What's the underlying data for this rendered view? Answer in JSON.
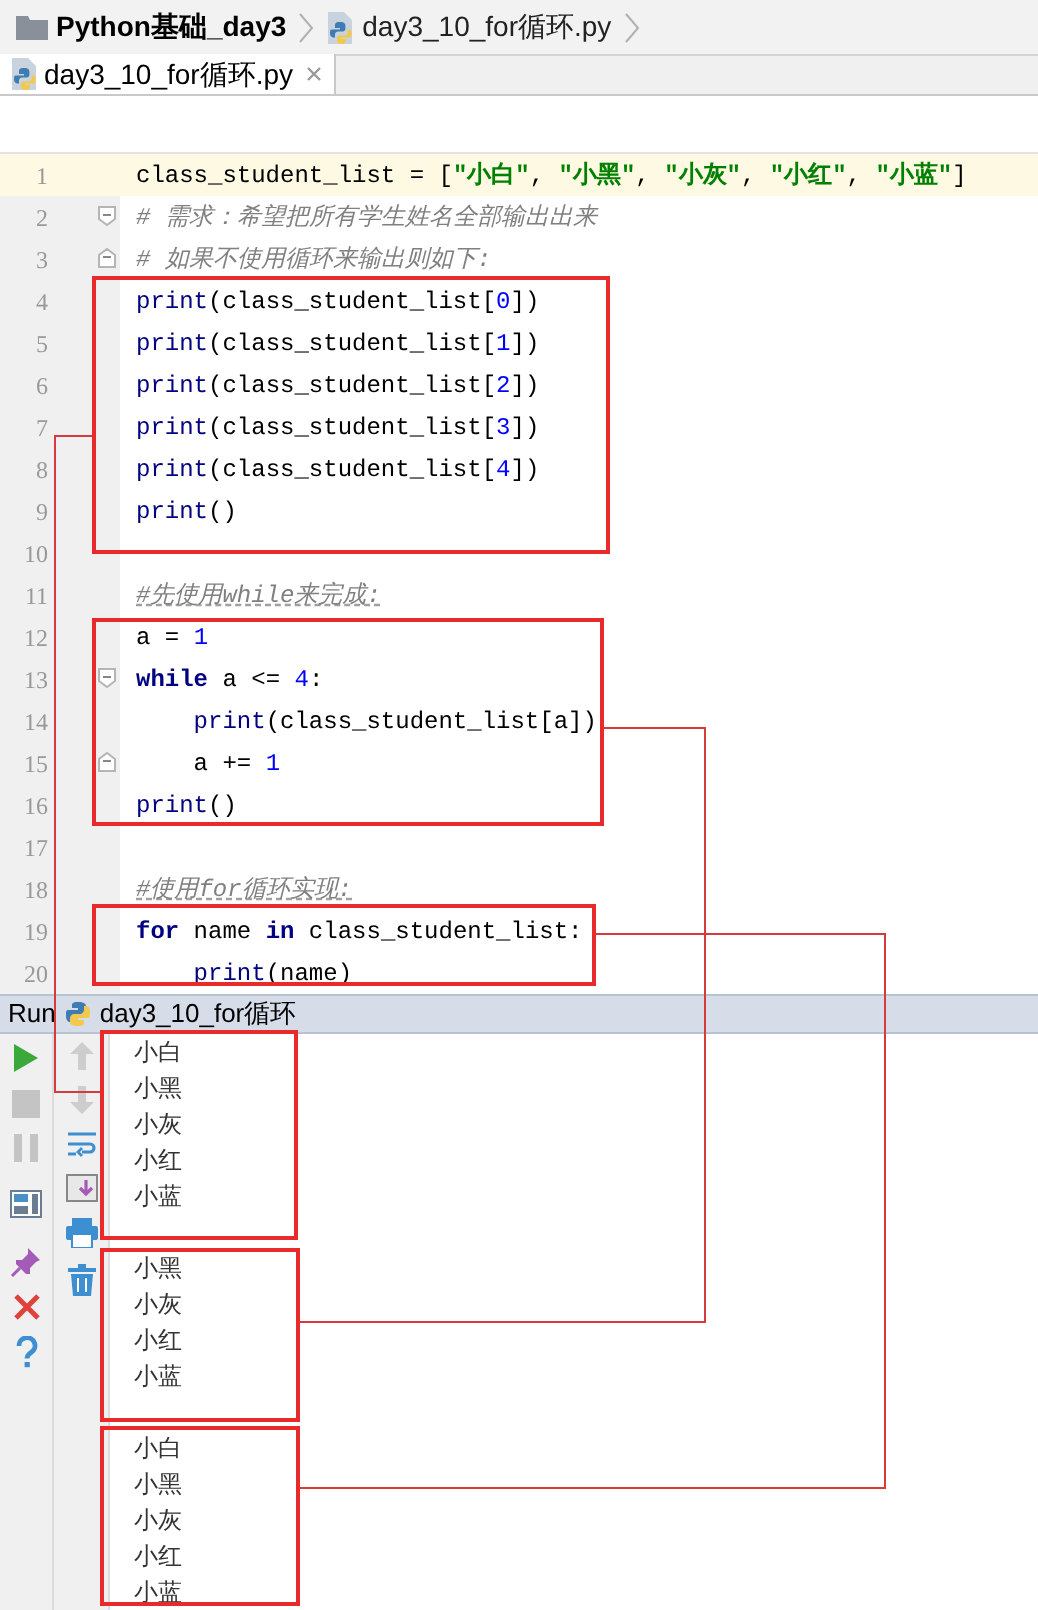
{
  "breadcrumb": [
    {
      "kind": "folder",
      "label": "Python基础_day3"
    },
    {
      "kind": "file",
      "label": "day3_10_for循环.py"
    }
  ],
  "tabs": [
    {
      "label": "day3_10_for循环.py",
      "selected": true
    }
  ],
  "editor": {
    "lines": [
      {
        "number": "1",
        "kind": "code",
        "current": true,
        "tokens": [
          {
            "kind": "plain",
            "text": "class_student_list = ["
          },
          {
            "kind": "string",
            "text": "\"小白\""
          },
          {
            "kind": "plain",
            "text": ", "
          },
          {
            "kind": "string",
            "text": "\"小黑\""
          },
          {
            "kind": "plain",
            "text": ", "
          },
          {
            "kind": "string",
            "text": "\"小灰\""
          },
          {
            "kind": "plain",
            "text": ", "
          },
          {
            "kind": "string",
            "text": "\"小红\""
          },
          {
            "kind": "plain",
            "text": ", "
          },
          {
            "kind": "string",
            "text": "\"小蓝\""
          },
          {
            "kind": "plain",
            "text": "]"
          }
        ]
      },
      {
        "number": "2",
        "kind": "fold_start",
        "current": false,
        "tokens": [
          {
            "kind": "comment",
            "text": "# 需求：希望把所有学生姓名全部输出出来"
          }
        ]
      },
      {
        "number": "3",
        "kind": "fold_end",
        "current": false,
        "tokens": [
          {
            "kind": "comment",
            "text": "# 如果不使用循环来输出则如下:"
          }
        ]
      },
      {
        "number": "4",
        "kind": "code",
        "current": false,
        "tokens": [
          {
            "kind": "builtin",
            "text": "print"
          },
          {
            "kind": "plain",
            "text": "(class_student_list["
          },
          {
            "kind": "number",
            "text": "0"
          },
          {
            "kind": "plain",
            "text": "])"
          }
        ]
      },
      {
        "number": "5",
        "kind": "code",
        "current": false,
        "tokens": [
          {
            "kind": "builtin",
            "text": "print"
          },
          {
            "kind": "plain",
            "text": "(class_student_list["
          },
          {
            "kind": "number",
            "text": "1"
          },
          {
            "kind": "plain",
            "text": "])"
          }
        ]
      },
      {
        "number": "6",
        "kind": "code",
        "current": false,
        "tokens": [
          {
            "kind": "builtin",
            "text": "print"
          },
          {
            "kind": "plain",
            "text": "(class_student_list["
          },
          {
            "kind": "number",
            "text": "2"
          },
          {
            "kind": "plain",
            "text": "])"
          }
        ]
      },
      {
        "number": "7",
        "kind": "code",
        "current": false,
        "tokens": [
          {
            "kind": "builtin",
            "text": "print"
          },
          {
            "kind": "plain",
            "text": "(class_student_list["
          },
          {
            "kind": "number",
            "text": "3"
          },
          {
            "kind": "plain",
            "text": "])"
          }
        ]
      },
      {
        "number": "8",
        "kind": "code",
        "current": false,
        "tokens": [
          {
            "kind": "builtin",
            "text": "print"
          },
          {
            "kind": "plain",
            "text": "(class_student_list["
          },
          {
            "kind": "number",
            "text": "4"
          },
          {
            "kind": "plain",
            "text": "])"
          }
        ]
      },
      {
        "number": "9",
        "kind": "code",
        "current": false,
        "tokens": [
          {
            "kind": "builtin",
            "text": "print"
          },
          {
            "kind": "plain",
            "text": "()"
          }
        ]
      },
      {
        "number": "10",
        "kind": "code",
        "current": false
      },
      {
        "number": "11",
        "kind": "code",
        "current": false,
        "tokens": [
          {
            "kind": "comment_marked",
            "text": "#先使用while来完成:"
          }
        ]
      },
      {
        "number": "12",
        "kind": "code",
        "current": false,
        "tokens": [
          {
            "kind": "plain",
            "text": "a = "
          },
          {
            "kind": "number",
            "text": "1"
          }
        ]
      },
      {
        "number": "13",
        "kind": "fold_start",
        "current": false,
        "tokens": [
          {
            "kind": "keyword",
            "text": "while"
          },
          {
            "kind": "plain",
            "text": " a <= "
          },
          {
            "kind": "number",
            "text": "4"
          },
          {
            "kind": "plain",
            "text": ":"
          }
        ]
      },
      {
        "number": "14",
        "kind": "code",
        "current": false,
        "tokens": [
          {
            "kind": "builtin",
            "text": "    print"
          },
          {
            "kind": "plain",
            "text": "(class_student_list[a])"
          }
        ]
      },
      {
        "number": "15",
        "kind": "fold_end",
        "current": false,
        "tokens": [
          {
            "kind": "plain",
            "text": "    a += "
          },
          {
            "kind": "number",
            "text": "1"
          }
        ]
      },
      {
        "number": "16",
        "kind": "code",
        "current": false,
        "tokens": [
          {
            "kind": "builtin",
            "text": "print"
          },
          {
            "kind": "plain",
            "text": "()"
          }
        ]
      },
      {
        "number": "17",
        "kind": "code",
        "current": false
      },
      {
        "number": "18",
        "kind": "code",
        "current": false,
        "tokens": [
          {
            "kind": "comment_marked",
            "text": "#使用for循环实现:"
          }
        ]
      },
      {
        "number": "19",
        "kind": "code",
        "current": false,
        "tokens": [
          {
            "kind": "keyword",
            "text": "for"
          },
          {
            "kind": "plain",
            "text": " name "
          },
          {
            "kind": "keyword",
            "text": "in"
          },
          {
            "kind": "plain",
            "text": " class_student_list:"
          }
        ]
      },
      {
        "number": "20",
        "kind": "code",
        "current": false,
        "tokens": [
          {
            "kind": "builtin",
            "text": "    print"
          },
          {
            "kind": "plain",
            "text": "(name)"
          }
        ]
      }
    ]
  },
  "run_panel": {
    "title": "Run",
    "config": "day3_10_for循环",
    "output_blocks": [
      [
        "小白",
        "小黑",
        "小灰",
        "小红",
        "小蓝"
      ],
      [
        "小黑",
        "小灰",
        "小红",
        "小蓝"
      ],
      [
        "小白",
        "小黑",
        "小灰",
        "小红",
        "小蓝"
      ]
    ]
  }
}
